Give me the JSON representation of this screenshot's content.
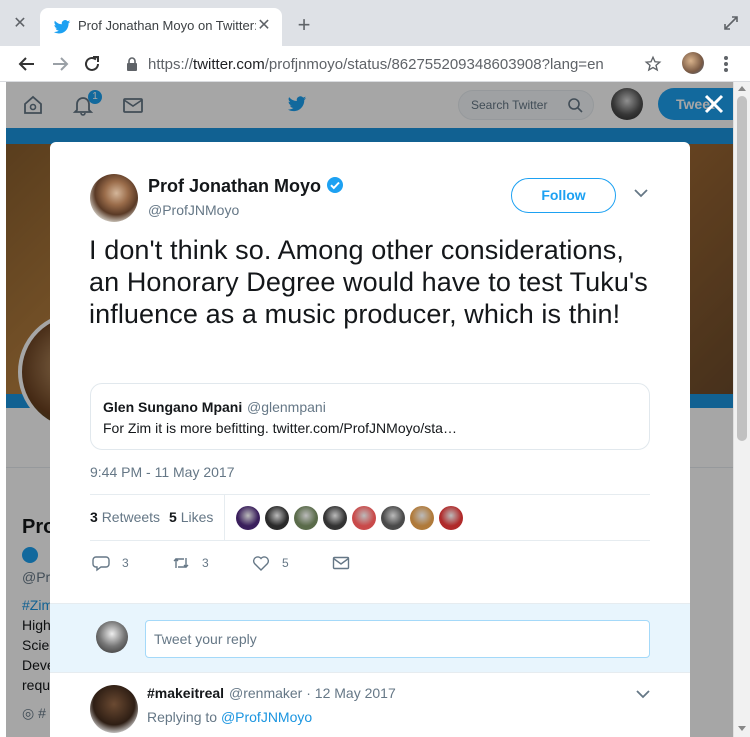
{
  "browser": {
    "tab_title": "Prof Jonathan Moyo on Twitter: \"I don't think so...",
    "url_prefix": "https://",
    "url_host": "twitter.com",
    "url_path": "/profjnmoyo/status/862755209348603908?lang=en"
  },
  "twitter_nav": {
    "notification_count": "1",
    "search_placeholder": "Search Twitter",
    "tweet_button": "Tweet"
  },
  "background_profile": {
    "name": "Pro",
    "handle": "@Pr",
    "bio_tag": "#Zim",
    "bio_lines": [
      "High",
      "Scie",
      "Deve",
      "requ"
    ],
    "location": "#"
  },
  "tweet": {
    "author_name": "Prof Jonathan Moyo",
    "author_handle": "@ProfJNMoyo",
    "follow_label": "Follow",
    "text": "I don't think so. Among other considerations, an Honorary Degree would have to test Tuku's influence as a music producer, which is thin!",
    "quote": {
      "name": "Glen Sungano Mpani",
      "handle": "@glenmpani",
      "text": "For Zim it is more befitting. twitter.com/ProfJNMoyo/sta…"
    },
    "timestamp": "9:44 PM - 11 May 2017",
    "retweets_count": "3",
    "retweets_label": "Retweets",
    "likes_count": "5",
    "likes_label": "Likes",
    "likers": [
      "#3a1f5c",
      "#2a2a2a",
      "#5a6b4a",
      "#333333",
      "#c94a4a",
      "#4a4a4a",
      "#b07a3a",
      "#b02a2a"
    ],
    "actions": {
      "replies": "3",
      "retweets": "3",
      "likes": "5"
    }
  },
  "reply_box": {
    "placeholder": "Tweet your reply"
  },
  "reply_tweet": {
    "name": "#makeitreal",
    "handle": "@renmaker · 12 May 2017",
    "replying_prefix": "Replying to",
    "replying_to": "@ProfJNMoyo"
  },
  "colors": {
    "twitter_blue": "#1da1f2",
    "link_blue": "#1b95e0",
    "text_primary": "#14171a",
    "text_secondary": "#657786"
  }
}
